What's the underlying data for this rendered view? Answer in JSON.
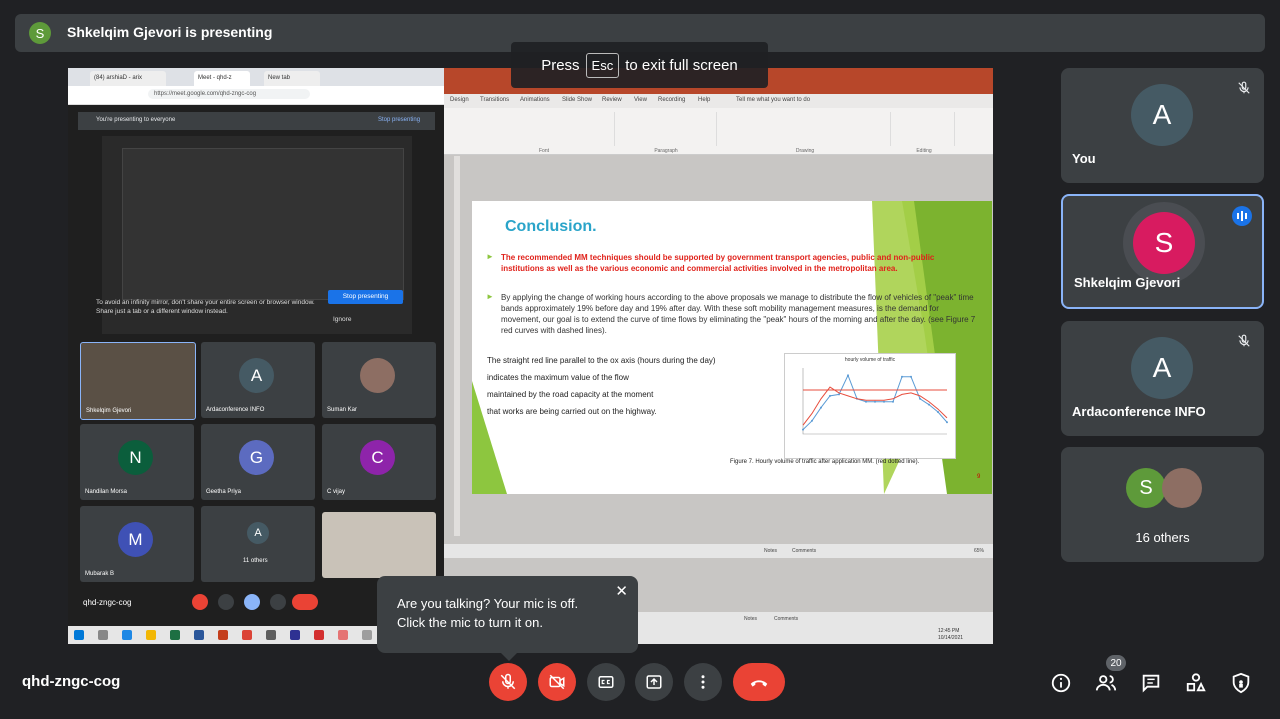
{
  "banner": {
    "avatar_letter": "S",
    "text": "Shkelqim Gjevori is presenting"
  },
  "esc_hint": {
    "press": "Press",
    "key": "Esc",
    "rest": "to exit full screen"
  },
  "shared_screen": {
    "chrome_tabs": [
      "(84) arshiaD - arix",
      "Meet - qhd-z",
      "New tab"
    ],
    "url": "https://meet.google.com/qhd-zngc-cog",
    "share_bar_text": "You're presenting to everyone",
    "share_bar_stop": "Stop presenting",
    "avoid_text": "To avoid an infinity mirror, don't share your entire screen or browser window. Share just a tab or a different window instead.",
    "stop_button": "Stop presenting",
    "ignore": "Ignore",
    "mini_tiles": [
      {
        "name": "Shkelqim Gjevori",
        "letter": "",
        "color": "#555"
      },
      {
        "name": "Ardaconference INFO",
        "letter": "A",
        "color": "#455a64"
      },
      {
        "name": "Suman Kar",
        "letter": "",
        "color": "#8d6e63"
      },
      {
        "name": "Nandilan Morsa",
        "letter": "N",
        "color": "#0b5e3c"
      },
      {
        "name": "Geetha Priya",
        "letter": "G",
        "color": "#5c6bc0"
      },
      {
        "name": "C vijay",
        "letter": "C",
        "color": "#8e24aa"
      },
      {
        "name": "Mubarak B",
        "letter": "M",
        "color": "#3f51b5"
      },
      {
        "name": "11 others",
        "letter": "A",
        "color": "#455a64"
      }
    ],
    "mini_meeting_code": "qhd-zngc-cog"
  },
  "ppt": {
    "ribbon_tabs": [
      "Design",
      "Transitions",
      "Animations",
      "Slide Show",
      "Review",
      "View",
      "Recording",
      "Help",
      "Tell me what you want to do"
    ],
    "ribbon_groups": [
      "Font",
      "Paragraph",
      "Drawing",
      "Editing"
    ],
    "slide": {
      "title": "Conclusion.",
      "bullet1": "The recommended MM techniques should be supported by government transport agencies, public and non-public institutions as well as the various economic and commercial activities involved in the metropolitan area.",
      "bullet2": "By applying the change of working hours according to the above proposals we manage to distribute the flow of vehicles of \"peak\" time bands approximately 19% before day and 19% after day. With these soft mobility management measures, is the demand for movement, our goal is to extend the curve of time flows by eliminating the \"peak\" hours of the morning and after the day. (see Figure 7 red curves with dashed lines).",
      "para_lines": [
        "The straight red line parallel to the ox axis (hours during the day)",
        "indicates the maximum value of the flow",
        "maintained by the road capacity at the moment",
        "that works are being carried out on the highway."
      ],
      "figure_caption": "Figure 7. Hourly volume of traffic after application MM. (red dotted line).",
      "slide_number": "9"
    },
    "status_notes": "Notes",
    "status_comments": "Comments",
    "zoom": "65%",
    "clock_time": "12:45 PM",
    "clock_date": "10/14/2021"
  },
  "chart_data": {
    "type": "line",
    "title": "hourly volume of traffic",
    "series": [
      {
        "values": [
          300,
          900,
          1800,
          2600,
          2700,
          4000,
          2400,
          2200,
          2200,
          2200,
          2200,
          3900,
          3900,
          2400,
          2000,
          1500,
          800
        ]
      },
      {
        "values": [
          600,
          1400,
          2400,
          3200,
          2800,
          2600,
          2400,
          2300,
          2300,
          2300,
          2400,
          2700,
          2800,
          2600,
          2200,
          1700,
          1100
        ]
      },
      {
        "values": [
          3000,
          3000,
          3000,
          3000,
          3000,
          3000,
          3000,
          3000,
          3000,
          3000,
          3000,
          3000,
          3000,
          3000,
          3000,
          3000,
          3000
        ]
      }
    ],
    "colors": [
      "#5b9bd5",
      "#e74c3c",
      "#e74c3c"
    ],
    "ylim": [
      0,
      4500
    ]
  },
  "participants": [
    {
      "name": "You",
      "letter": "A",
      "color": "#455a64",
      "mic": "muted"
    },
    {
      "name": "Shkelqim Gjevori",
      "letter": "S",
      "color": "#d81b60",
      "mic": "speaking"
    },
    {
      "name": "Ardaconference INFO",
      "letter": "A",
      "color": "#455a64",
      "mic": "muted"
    },
    {
      "name": "16 others",
      "letter": "S",
      "color": "#5e9a3a",
      "mic": ""
    }
  ],
  "toast": {
    "message": "Are you talking? Your mic is off. Click the mic to turn it on.",
    "close": "✕"
  },
  "bottom": {
    "meeting_code": "qhd-zngc-cog",
    "people_count": "20",
    "icons": [
      "mic-off-icon",
      "camera-off-icon",
      "captions-icon",
      "present-icon",
      "more-icon",
      "hangup-icon",
      "info-icon",
      "people-icon",
      "chat-icon",
      "activities-icon",
      "host-controls-icon"
    ]
  }
}
